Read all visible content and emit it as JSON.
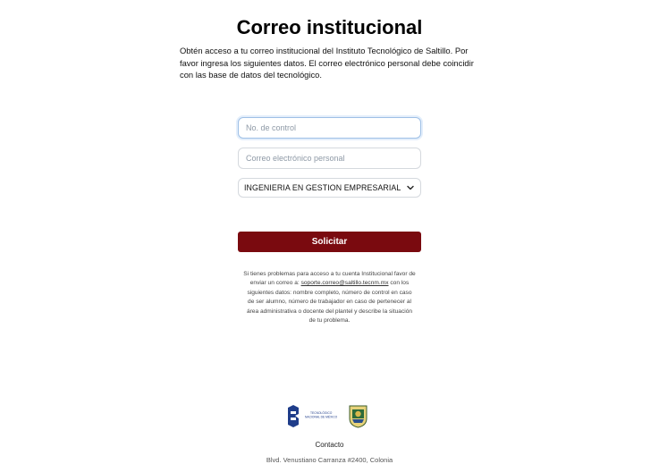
{
  "page": {
    "title": "Correo institucional",
    "intro": "Obtén acceso a tu correo institucional del Instituto Tecnológico de Saltillo. Por favor ingresa los siguientes datos. El correo electrónico personal debe coincidir con las base de datos del tecnológico."
  },
  "form": {
    "control_placeholder": "No. de control",
    "email_placeholder": "Correo electrónico personal",
    "career_selected": "INGENIERIA EN GESTION EMPRESARIAL",
    "submit_label": "Solicitar"
  },
  "help": {
    "text_before": "Si tienes problemas para acceso a tu cuenta Institucional favor de enviar un correo a:",
    "email": "soporte.correo@saltillo.tecnm.mx",
    "text_after": "con los siguientes datos: nombre completo, número de control en caso de ser alumno, número de trabajador en caso de pertenecer al área administrativa o docente del plantel y describe la situación de tu problema."
  },
  "footer": {
    "logo_text_line1": "TECNOLÓGICO",
    "logo_text_line2": "NACIONAL DE MÉXICO",
    "contact_label": "Contacto",
    "address": "Blvd. Venustiano Carranza #2400, Colonia"
  },
  "colors": {
    "accent": "#7a0a0f",
    "logo_blue": "#1f3d8a"
  },
  "icons": {
    "select_chevron": "chevron-down-icon",
    "tecnm_logo": "tecnm-logo-icon",
    "shield_logo": "its-shield-icon"
  }
}
